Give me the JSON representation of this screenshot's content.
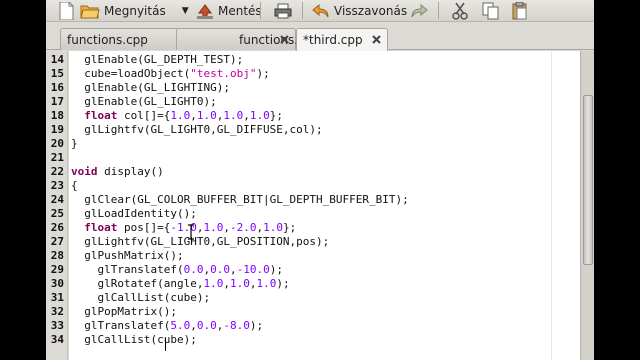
{
  "toolbar": {
    "items": [
      {
        "label": "",
        "icon": "new-file-icon"
      },
      {
        "label": "Megnyitás",
        "icon": "folder-open-icon"
      },
      {
        "label": "Mentés",
        "icon": "save-icon"
      },
      {
        "label": "",
        "icon": "print-icon"
      },
      {
        "label": "Visszavonás",
        "icon": "undo-icon"
      },
      {
        "label": "",
        "icon": "redo-icon"
      },
      {
        "label": "",
        "icon": "cut-icon"
      },
      {
        "label": "",
        "icon": "copy-icon"
      },
      {
        "label": "",
        "icon": "paste-icon"
      }
    ]
  },
  "tabs": [
    {
      "label": "functions.cpp",
      "active": false
    },
    {
      "label": "functions.h",
      "active": false
    },
    {
      "label": "*third.cpp",
      "active": true
    }
  ],
  "editor": {
    "lines": [
      {
        "num": "14",
        "text": "  glEnable(GL_DEPTH_TEST);"
      },
      {
        "num": "15",
        "text": "  cube=loadObject(\"test.obj\");"
      },
      {
        "num": "16",
        "text": "  glEnable(GL_LIGHTING);"
      },
      {
        "num": "17",
        "text": "  glEnable(GL_LIGHT0);"
      },
      {
        "num": "18",
        "text": "  float col[]={1.0,1.0,1.0,1.0};"
      },
      {
        "num": "19",
        "text": "  glLightfv(GL_LIGHT0,GL_DIFFUSE,col);"
      },
      {
        "num": "20",
        "text": "}"
      },
      {
        "num": "21",
        "text": ""
      },
      {
        "num": "22",
        "text": "void display()"
      },
      {
        "num": "23",
        "text": "{"
      },
      {
        "num": "24",
        "text": "  glClear(GL_COLOR_BUFFER_BIT|GL_DEPTH_BUFFER_BIT);"
      },
      {
        "num": "25",
        "text": "  glLoadIdentity();"
      },
      {
        "num": "26",
        "text": "  float pos[]={-1.0,1.0,-2.0,1.0};"
      },
      {
        "num": "27",
        "text": "  glLightfv(GL_LIGHT0,GL_POSITION,pos);"
      },
      {
        "num": "28",
        "text": "  glPushMatrix();"
      },
      {
        "num": "29",
        "text": "    glTranslatef(0.0,0.0,-10.0);"
      },
      {
        "num": "30",
        "text": "    glRotatef(angle,1.0,1.0,1.0);"
      },
      {
        "num": "31",
        "text": "    glCallList(cube);"
      },
      {
        "num": "32",
        "text": "  glPopMatrix();"
      },
      {
        "num": "33",
        "text": "  glTranslatef(5.0,0.0,-8.0);"
      },
      {
        "num": "34",
        "text": "  glCallList(cube);"
      }
    ],
    "keywords": [
      "float",
      "void"
    ],
    "colors": {
      "keyword": "#7f0055",
      "string": "#c000a0",
      "number": "#8000ff"
    }
  }
}
